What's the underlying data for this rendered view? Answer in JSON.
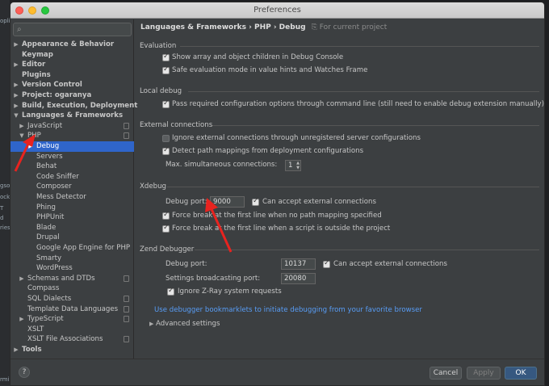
{
  "window": {
    "title": "Preferences"
  },
  "backdrop": {
    "fragments": [
      "opli",
      "gsor",
      "ock",
      "T",
      "d",
      "ries",
      "rmi"
    ]
  },
  "sidebar": {
    "items": [
      {
        "label": "Appearance & Behavior",
        "arrow": "▶",
        "bold": true
      },
      {
        "label": "Keymap",
        "arrow": "",
        "bold": true
      },
      {
        "label": "Editor",
        "arrow": "▶",
        "bold": true
      },
      {
        "label": "Plugins",
        "arrow": "",
        "bold": true
      },
      {
        "label": "Version Control",
        "arrow": "▶",
        "bold": true
      },
      {
        "label": "Project: ogaranya",
        "arrow": "▶",
        "bold": true
      },
      {
        "label": "Build, Execution, Deployment",
        "arrow": "▶",
        "bold": true
      },
      {
        "label": "Languages & Frameworks",
        "arrow": "▼",
        "bold": true
      },
      {
        "label": "JavaScript",
        "arrow": "▶",
        "bold": false
      },
      {
        "label": "PHP",
        "arrow": "▼",
        "bold": false
      },
      {
        "label": "Debug",
        "arrow": "▶",
        "bold": false
      },
      {
        "label": "Servers",
        "arrow": "",
        "bold": false
      },
      {
        "label": "Behat",
        "arrow": "",
        "bold": false
      },
      {
        "label": "Code Sniffer",
        "arrow": "",
        "bold": false
      },
      {
        "label": "Composer",
        "arrow": "",
        "bold": false
      },
      {
        "label": "Mess Detector",
        "arrow": "",
        "bold": false
      },
      {
        "label": "Phing",
        "arrow": "",
        "bold": false
      },
      {
        "label": "PHPUnit",
        "arrow": "",
        "bold": false
      },
      {
        "label": "Blade",
        "arrow": "",
        "bold": false
      },
      {
        "label": "Drupal",
        "arrow": "",
        "bold": false
      },
      {
        "label": "Google App Engine for PHP",
        "arrow": "",
        "bold": false
      },
      {
        "label": "Smarty",
        "arrow": "",
        "bold": false
      },
      {
        "label": "WordPress",
        "arrow": "",
        "bold": false
      },
      {
        "label": "Schemas and DTDs",
        "arrow": "▶",
        "bold": false
      },
      {
        "label": "Compass",
        "arrow": "",
        "bold": false
      },
      {
        "label": "SQL Dialects",
        "arrow": "",
        "bold": false
      },
      {
        "label": "Template Data Languages",
        "arrow": "",
        "bold": false
      },
      {
        "label": "TypeScript",
        "arrow": "▶",
        "bold": false
      },
      {
        "label": "XSLT",
        "arrow": "",
        "bold": false
      },
      {
        "label": "XSLT File Associations",
        "arrow": "",
        "bold": false
      },
      {
        "label": "Tools",
        "arrow": "▶",
        "bold": true
      }
    ],
    "help_label": "?"
  },
  "content": {
    "breadcrumb": "Languages & Frameworks › PHP › Debug",
    "scope": "For current project",
    "evaluation": {
      "title": "Evaluation",
      "show_array": "Show array and object children in Debug Console",
      "safe_eval": "Safe evaluation mode in value hints and Watches Frame"
    },
    "local_debug": {
      "title": "Local debug",
      "pass_required": "Pass required configuration options through command line (still need to enable debug extension manually)"
    },
    "external": {
      "title": "External connections",
      "ignore_unregistered": "Ignore external connections through unregistered server configurations",
      "detect_mappings": "Detect path mappings from deployment configurations",
      "max_label": "Max. simultaneous connections:",
      "max_value": "1"
    },
    "xdebug": {
      "title": "Xdebug",
      "port_label": "Debug port:",
      "port_value": "9000",
      "accept_external": "Can accept external connections",
      "force_break_first": "Force break at the first line when no path mapping specified",
      "force_break_outside": "Force break at the first line when a script is outside the project"
    },
    "zend": {
      "title": "Zend Debugger",
      "port_label": "Debug port:",
      "port_value": "10137",
      "accept_external": "Can accept external connections",
      "broadcast_label": "Settings broadcasting port:",
      "broadcast_value": "20080",
      "ignore_zray": "Ignore Z-Ray system requests"
    },
    "bookmarklets_link": "Use debugger bookmarklets to initiate debugging from your favorite browser",
    "advanced": "Advanced settings"
  },
  "footer": {
    "cancel": "Cancel",
    "apply": "Apply",
    "ok": "OK"
  },
  "annotations": {
    "arrow_color": "#e8231f"
  }
}
